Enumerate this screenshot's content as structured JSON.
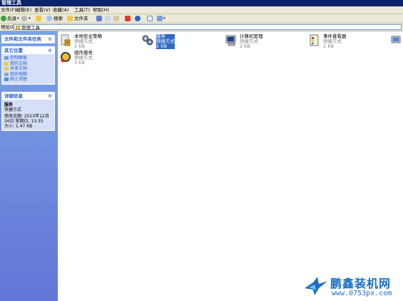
{
  "window": {
    "title": "管理工具"
  },
  "menu": [
    "文件(F)",
    "编辑(E)",
    "查看(V)",
    "收藏(A)",
    "工具(T)",
    "帮助(H)"
  ],
  "toolbar": {
    "back": "后退",
    "search": "搜索",
    "folders": "文件夹"
  },
  "address": {
    "label": "地址(D)",
    "value": "管理工具"
  },
  "tasks": {
    "title": "文件和文件夹任务"
  },
  "places": {
    "title": "其它位置",
    "items": [
      "控制面板",
      "我的文档",
      "共享文档",
      "我的电脑",
      "网上邻居"
    ]
  },
  "details": {
    "title": "详细信息",
    "name": "服务",
    "type": "快捷方式",
    "modified": "修改日期: 2010年12月26日 星期日, 13:35",
    "size": "大小: 1.47 KB"
  },
  "files": [
    {
      "name": "本地安全策略",
      "type": "快捷方式",
      "size": "2 KB"
    },
    {
      "name": "服务",
      "type": "快捷方式",
      "size": "2 KB",
      "selected": true
    },
    {
      "name": "计算机管理",
      "type": "快捷方式",
      "size": "2 KB"
    },
    {
      "name": "事件查看器",
      "type": "快捷方式",
      "size": "2 KB"
    },
    {
      "name": "组件服务",
      "type": "快捷方式",
      "size": "3 KB"
    }
  ],
  "watermark": {
    "name": "鹏鑫装机网",
    "url": "www.0753px.com"
  }
}
